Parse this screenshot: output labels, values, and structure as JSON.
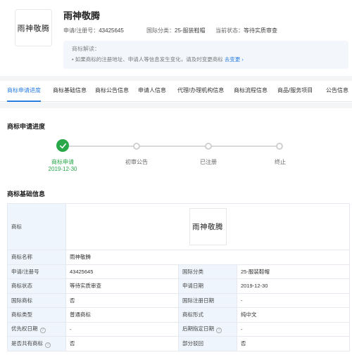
{
  "trademark": {
    "logo_text": "雨神敬腾",
    "name": "雨神敬腾",
    "reg_no_label": "申请/注册号：",
    "reg_no": "43425645",
    "intl_class_label": "国际分类：",
    "intl_class": "25-服装鞋帽",
    "status_label": "当前状态：",
    "status": "等待实质审查"
  },
  "explain": {
    "title": "商标解读：",
    "text": "• 如果商标的注册地址、申请人等信息发生变化，请及时变更商标",
    "link": "去变更",
    "link_icon": "chevron-right-icon"
  },
  "tabs": [
    {
      "label": "商标申请进度",
      "active": true
    },
    {
      "label": "商标基础信息",
      "active": false
    },
    {
      "label": "商标公告信息",
      "active": false
    },
    {
      "label": "申请人信息",
      "active": false
    },
    {
      "label": "代理/办理机构信息",
      "active": false
    },
    {
      "label": "商标流程信息",
      "active": false
    },
    {
      "label": "商品/服务项目",
      "active": false
    },
    {
      "label": "公告信息",
      "active": false
    }
  ],
  "progress": {
    "title": "商标申请进度",
    "steps": [
      {
        "label": "商标申请",
        "date": "2019-12-30",
        "done": true
      },
      {
        "label": "初审公告",
        "done": false
      },
      {
        "label": "已注册",
        "done": false
      },
      {
        "label": "终止",
        "done": false
      }
    ],
    "done_color": "#29a84a"
  },
  "basic_info": {
    "title": "商标基础信息",
    "mark_label": "商标",
    "rows": [
      {
        "k1": "商标名称",
        "v1": "雨神敬腾"
      },
      {
        "k1": "申请/注册号",
        "v1": "43425645",
        "k2": "国际分类",
        "v2": "25-服装鞋帽"
      },
      {
        "k1": "商标状态",
        "v1": "等待实质审查",
        "k2": "申请日期",
        "v2": "2019-12-30"
      },
      {
        "k1": "国际商标",
        "v1": "否",
        "k2": "国际注册日期",
        "v2": "-"
      },
      {
        "k1": "商标类型",
        "v1": "普通商标",
        "k2": "商标形式",
        "v2": "纯中文"
      },
      {
        "k1": "优先权日期",
        "v1": "-",
        "k2": "后期指定日期",
        "v2": "-"
      },
      {
        "k1": "是否共有商标",
        "v1": "否",
        "k2": "部分驳回",
        "v2": "否"
      }
    ],
    "help_icon": "question-circle-icon"
  },
  "colors": {
    "accent": "#2a7de1",
    "table_key_bg": "#eef5fc",
    "panel_bg": "#f3f7fc"
  }
}
